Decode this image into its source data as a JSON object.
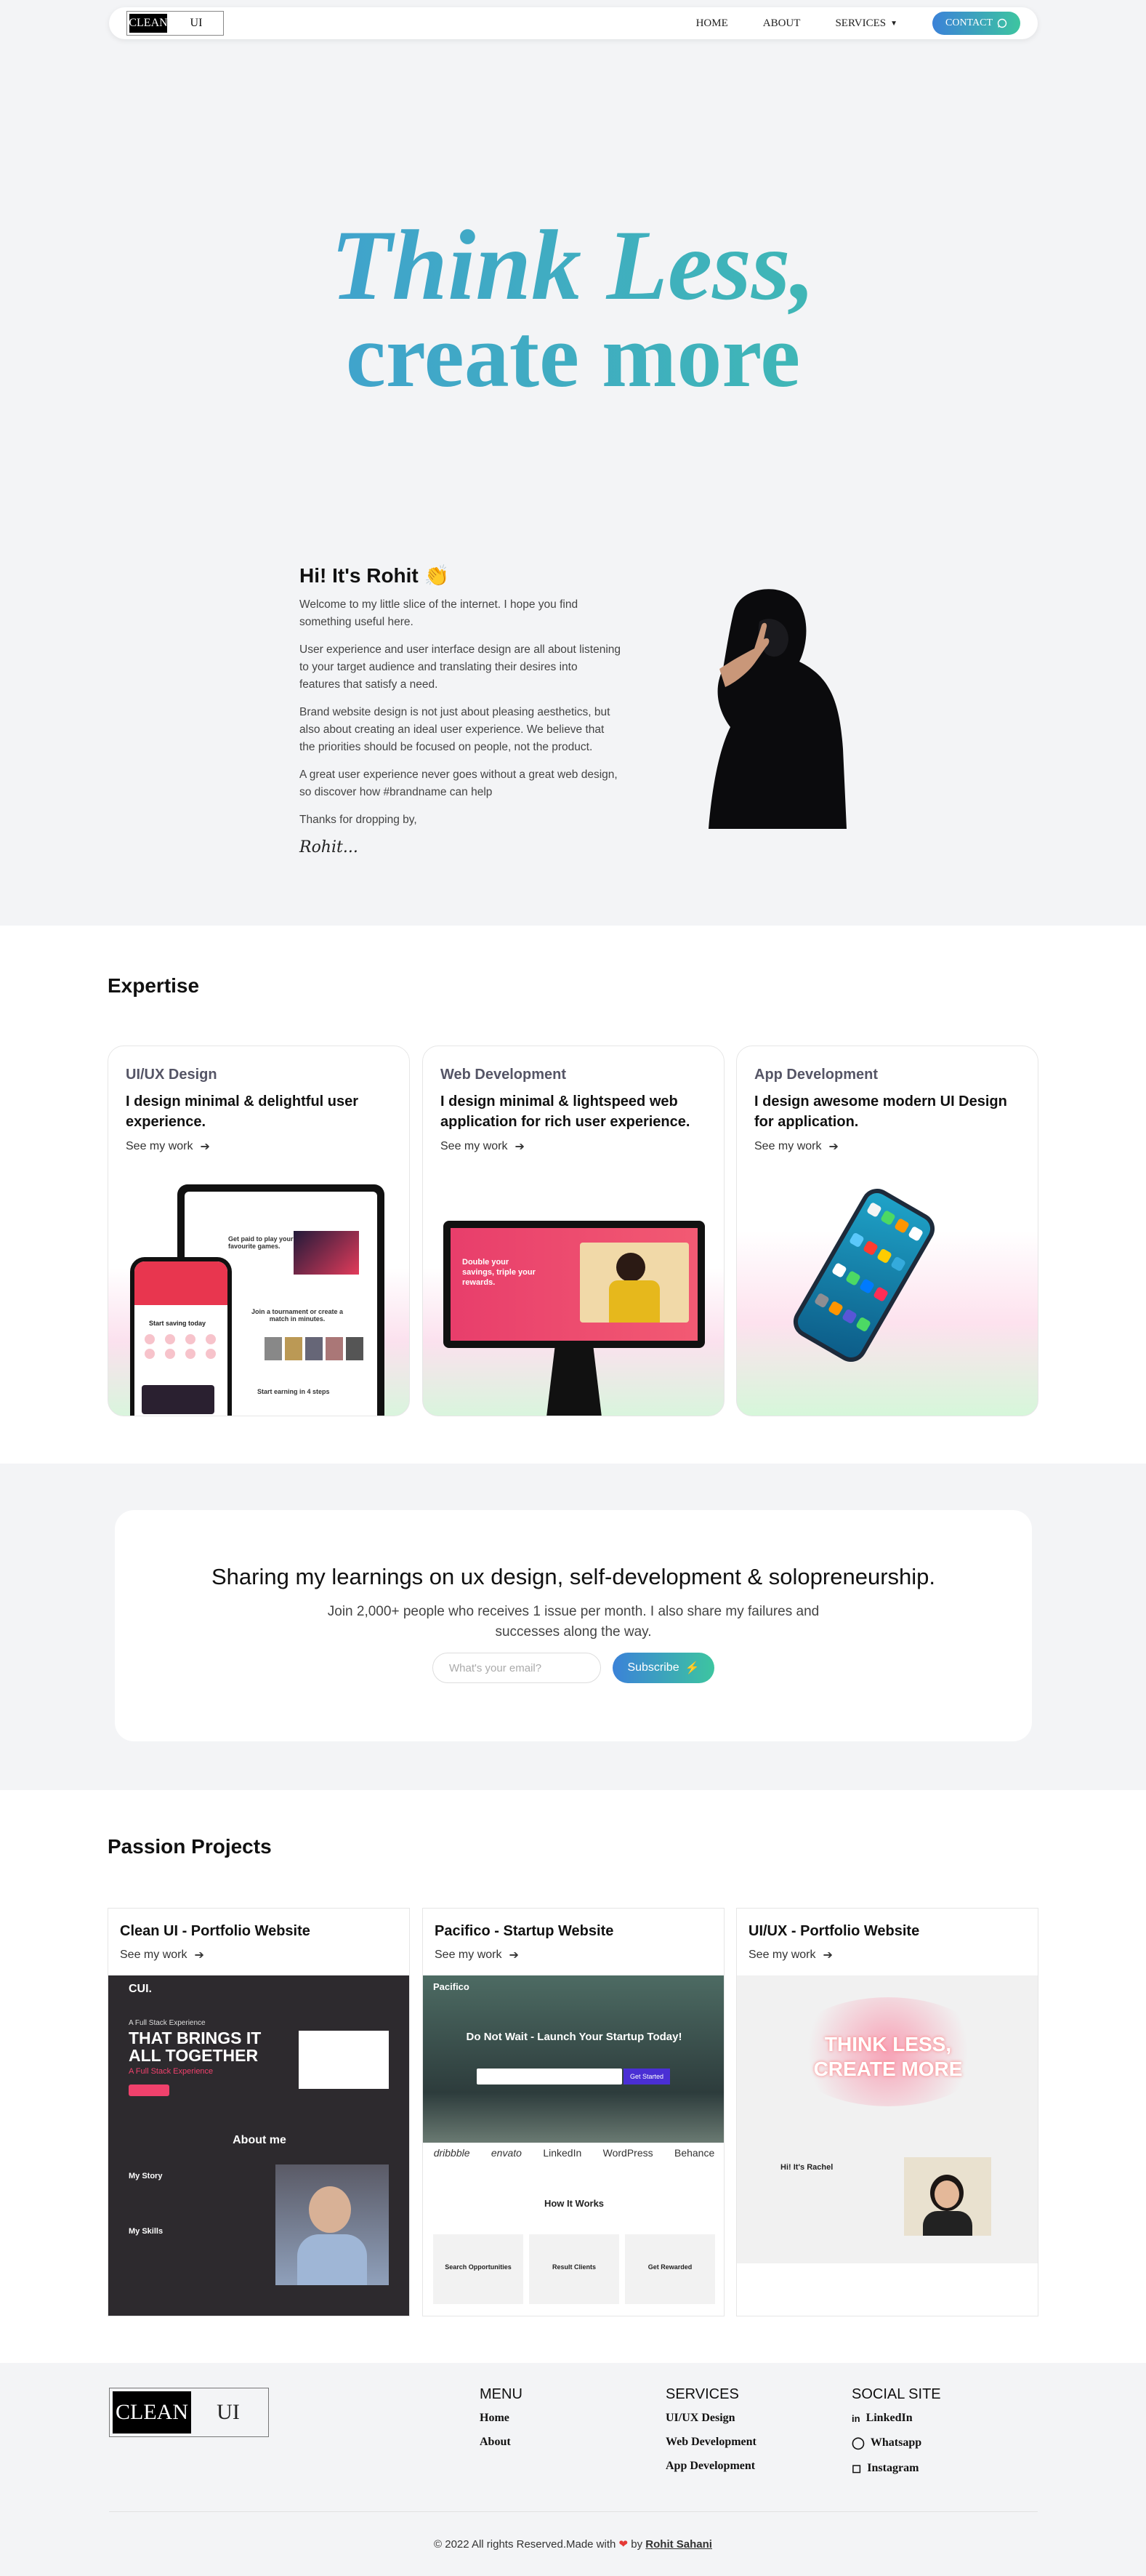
{
  "nav": {
    "logo_a": "CLEAN",
    "logo_b": "UI",
    "links": [
      "HOME",
      "ABOUT",
      "SERVICES"
    ],
    "contact": "CONTACT"
  },
  "hero": {
    "line1": "Think Less,",
    "line2": "create more"
  },
  "about": {
    "greeting": "Hi! It's Rohit",
    "wave": "👏",
    "paragraphs": [
      "Welcome to my little slice of the internet. I hope you find something useful here.",
      "User experience and user interface design are all about listening to your target audience and translating their desires into features that satisfy a need.",
      "Brand website design is not just about pleasing aesthetics, but also about creating an ideal user experience. We believe that the priorities should be focused on people, not the product.",
      "A great user experience never goes without a great web design, so discover how #brandname can help",
      "Thanks for dropping by,"
    ],
    "signature": "Rohit..."
  },
  "expertise": {
    "title": "Expertise",
    "see": "See my work",
    "cards": [
      {
        "category": "UI/UX Design",
        "desc": "I design minimal & delightful user experience."
      },
      {
        "category": "Web Development",
        "desc": "I design minimal & lightspeed web application for rich user experience."
      },
      {
        "category": "App Development",
        "desc": "I design awesome modern UI Design for application."
      }
    ],
    "mock": {
      "pass_text": "Get paid to play your favourite games.",
      "join_text": "Join a tournament or create a match in minutes.",
      "start_text": "Start earning in 4 steps",
      "phone_title": "Start saving today",
      "web_text": "Double your savings, triple your rewards."
    }
  },
  "newsletter": {
    "title": "Sharing my learnings on ux design, self-development & solopreneurship.",
    "text": "Join 2,000+ people who receives 1 issue per month. I also share my failures and successes along the way.",
    "placeholder": "What's your email?",
    "button": "Subscribe"
  },
  "projects": {
    "title": "Passion Projects",
    "see": "See my work",
    "cards": [
      {
        "title": "Clean UI - Portfolio Website"
      },
      {
        "title": "Pacifico - Startup Website"
      },
      {
        "title": "UI/UX - Portfolio Website"
      }
    ],
    "p1": {
      "logo": "CUI.",
      "tag": "A Full Stack Experience",
      "headline": "THAT BRINGS IT ALL TOGETHER",
      "sub": "A Full Stack Experience",
      "about": "About me",
      "story": "My Story",
      "skills": "My Skills"
    },
    "p2": {
      "logo": "Pacifico",
      "headline": "Do Not Wait - Launch Your Startup Today!",
      "cta": "Get Started",
      "brands": [
        "dribbble",
        "envato",
        "LinkedIn",
        "WordPress",
        "Behance"
      ],
      "how": "How It Works",
      "steps": [
        "Search Opportunities",
        "Result Clients",
        "Get Rewarded"
      ]
    },
    "p3": {
      "headline1": "THINK LESS,",
      "headline2": "CREATE MORE",
      "hi": "Hi! It's Rachel"
    }
  },
  "footer": {
    "logo_a": "CLEAN",
    "logo_b": "UI",
    "menu_title": "MENU",
    "menu": [
      "Home",
      "About"
    ],
    "services_title": "SERVICES",
    "services": [
      "UI/UX Design",
      "Web Development",
      "App Development"
    ],
    "social_title": "SOCIAL SITE",
    "social": [
      "LinkedIn",
      "Whatsapp",
      "Instagram"
    ],
    "copy_pre": "© 2022 All rights Reserved.Made with",
    "by": "by",
    "author": "Rohit Sahani"
  },
  "colors": {
    "accent_start": "#3b82d8",
    "accent_end": "#3dc5a0",
    "pink": "#f0416c"
  }
}
